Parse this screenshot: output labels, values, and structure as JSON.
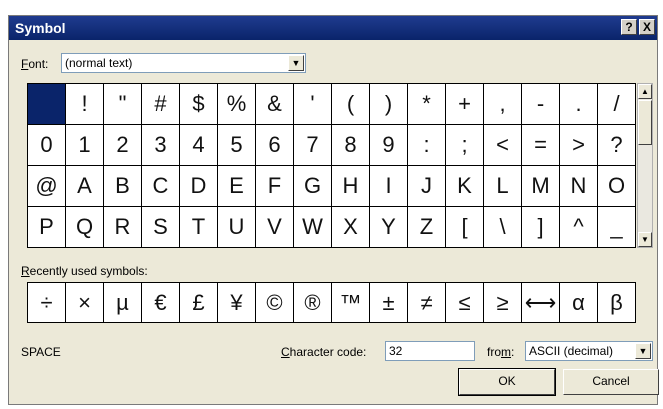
{
  "window": {
    "title": "Symbol",
    "help_label": "?",
    "close_label": "X"
  },
  "font": {
    "label_key": "F",
    "label_rest": "ont:",
    "value": "(normal text)"
  },
  "symbols": [
    " ",
    "!",
    "\"",
    "#",
    "$",
    "%",
    "&",
    "'",
    "(",
    ")",
    "*",
    "+",
    ",",
    "-",
    ".",
    "/",
    "0",
    "1",
    "2",
    "3",
    "4",
    "5",
    "6",
    "7",
    "8",
    "9",
    ":",
    ";",
    "<",
    "=",
    ">",
    "?",
    "@",
    "A",
    "B",
    "C",
    "D",
    "E",
    "F",
    "G",
    "H",
    "I",
    "J",
    "K",
    "L",
    "M",
    "N",
    "O",
    "P",
    "Q",
    "R",
    "S",
    "T",
    "U",
    "V",
    "W",
    "X",
    "Y",
    "Z",
    "[",
    "\\",
    "]",
    "^",
    "_"
  ],
  "selected_index": 0,
  "recent": {
    "label_key": "R",
    "label_rest": "ecently used symbols:",
    "items": [
      "÷",
      "×",
      "µ",
      "€",
      "£",
      "¥",
      "©",
      "®",
      "™",
      "±",
      "≠",
      "≤",
      "≥",
      "⟷",
      "α",
      "β"
    ]
  },
  "status": {
    "symbol_name": "SPACE"
  },
  "char_code": {
    "label_key": "C",
    "label_rest": "haracter code:",
    "value": "32"
  },
  "from": {
    "label_pre": "fro",
    "label_key": "m",
    "label_post": ":",
    "value": "ASCII (decimal)"
  },
  "buttons": {
    "ok": "OK",
    "cancel": "Cancel"
  }
}
